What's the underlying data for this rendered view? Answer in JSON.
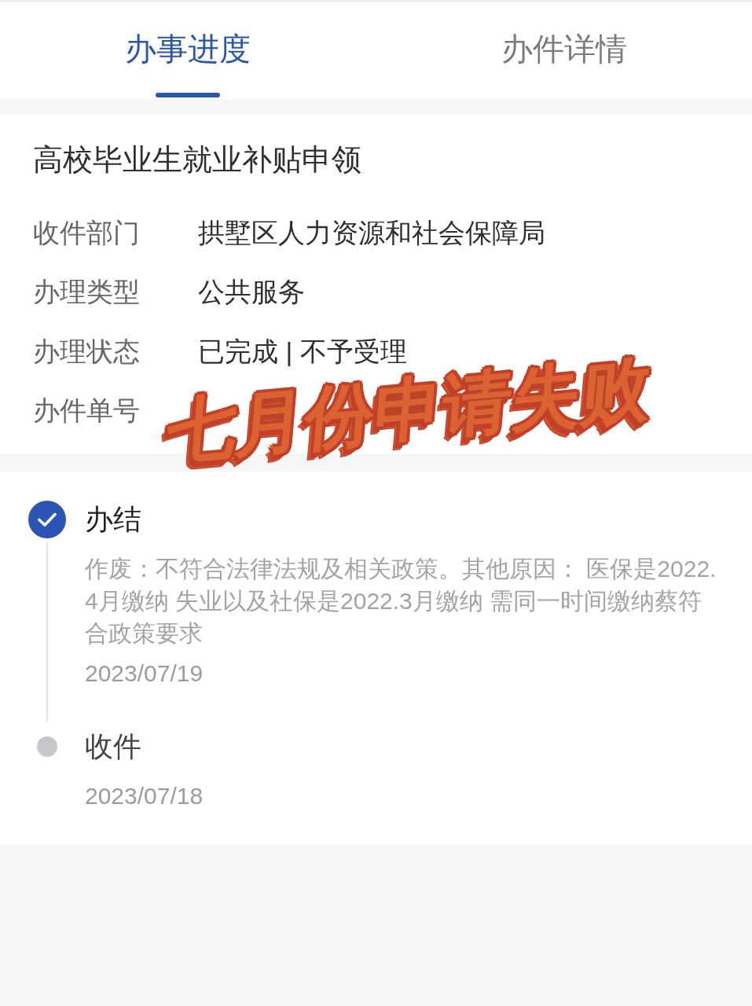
{
  "tabs": [
    {
      "label": "办事进度",
      "selected": true
    },
    {
      "label": "办件详情",
      "selected": false
    }
  ],
  "application": {
    "title": "高校毕业生就业补贴申领",
    "fields": [
      {
        "label": "收件部门",
        "value": "拱墅区人力资源和社会保障局"
      },
      {
        "label": "办理类型",
        "value": "公共服务"
      },
      {
        "label": "办理状态",
        "value": "已完成 | 不予受理"
      },
      {
        "label": "办件单号"
      }
    ]
  },
  "timeline": [
    {
      "title": "办结",
      "done": true,
      "description": "作废：不符合法律法规及相关政策。其他原因： 医保是2022.4月缴纳 失业以及社保是2022.3月缴纳 需同一时间缴纳蔡符合政策要求",
      "date": "2023/07/19"
    },
    {
      "title": "收件",
      "done": false,
      "date": "2023/07/18"
    }
  ],
  "sticker": {
    "text": "七月份申请失败"
  }
}
